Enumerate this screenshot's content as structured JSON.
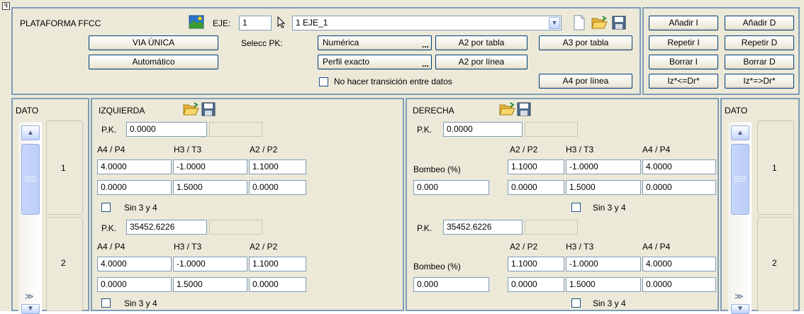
{
  "colors": {
    "window_bg": "#ece9d8",
    "border": "#7f9db9",
    "button_border": "#003c74"
  },
  "top": {
    "title": "PLATAFORMA FFCC",
    "eje_label": "EJE:",
    "eje_value": "1",
    "eje_select": "1 EJE_1",
    "via_unica": "VIA ÚNICA",
    "automatico": "Automático",
    "selecc_pk": "Selecc PK:",
    "numerica": "Numérica",
    "perfil_exacto": "Perfil exacto",
    "a2_tabla": "A2 por tabla",
    "a2_linea": "A2 por línea",
    "a3_tabla": "A3 por tabla",
    "a4_linea": "A4 por línea",
    "no_transicion": "No hacer transición entre datos",
    "dots": "..."
  },
  "actions": {
    "anadir_i": "Añadir I",
    "anadir_d": "Añadir D",
    "repetir_i": "Repetir I",
    "repetir_d": "Repetir D",
    "borrar_i": "Borrar I",
    "borrar_d": "Borrar D",
    "iz_le_dr": "Iz*<=Dr*",
    "iz_ge_dr": "Iz*=>Dr*"
  },
  "dato_label": "DATO",
  "dato_items": [
    "1",
    "2"
  ],
  "left": {
    "title": "IZQUIERDA",
    "blocks": [
      {
        "pk_label": "P.K.",
        "pk": "0.0000",
        "headers": [
          "A4 / P4",
          "H3 / T3",
          "A2 / P2"
        ],
        "row1": [
          "4.0000",
          "-1.0000",
          "1.1000"
        ],
        "row2": [
          "0.0000",
          "1.5000",
          "0.0000"
        ],
        "sin": "Sin 3 y 4"
      },
      {
        "pk_label": "P.K.",
        "pk": "35452.6226",
        "headers": [
          "A4 / P4",
          "H3 / T3",
          "A2 / P2"
        ],
        "row1": [
          "4.0000",
          "-1.0000",
          "1.1000"
        ],
        "row2": [
          "0.0000",
          "1.5000",
          "0.0000"
        ],
        "sin": "Sin 3 y 4"
      }
    ]
  },
  "right": {
    "title": "DERECHA",
    "blocks": [
      {
        "pk_label": "P.K.",
        "pk": "0.0000",
        "bombeo_label": "Bombeo (%)",
        "bombeo": "0.000",
        "headers": [
          "A2 / P2",
          "H3 / T3",
          "A4 / P4"
        ],
        "row1": [
          "1.1000",
          "-1.0000",
          "4.0000"
        ],
        "row2": [
          "0.0000",
          "1.5000",
          "0.0000"
        ],
        "sin": "Sin 3 y 4"
      },
      {
        "pk_label": "P.K.",
        "pk": "35452.6226",
        "bombeo_label": "Bombeo (%)",
        "bombeo": "0.000",
        "headers": [
          "A2 / P2",
          "H3 / T3",
          "A4 / P4"
        ],
        "row1": [
          "1.1000",
          "-1.0000",
          "4.0000"
        ],
        "row2": [
          "0.0000",
          "1.5000",
          "0.0000"
        ],
        "sin": "Sin 3 y 4"
      }
    ]
  }
}
